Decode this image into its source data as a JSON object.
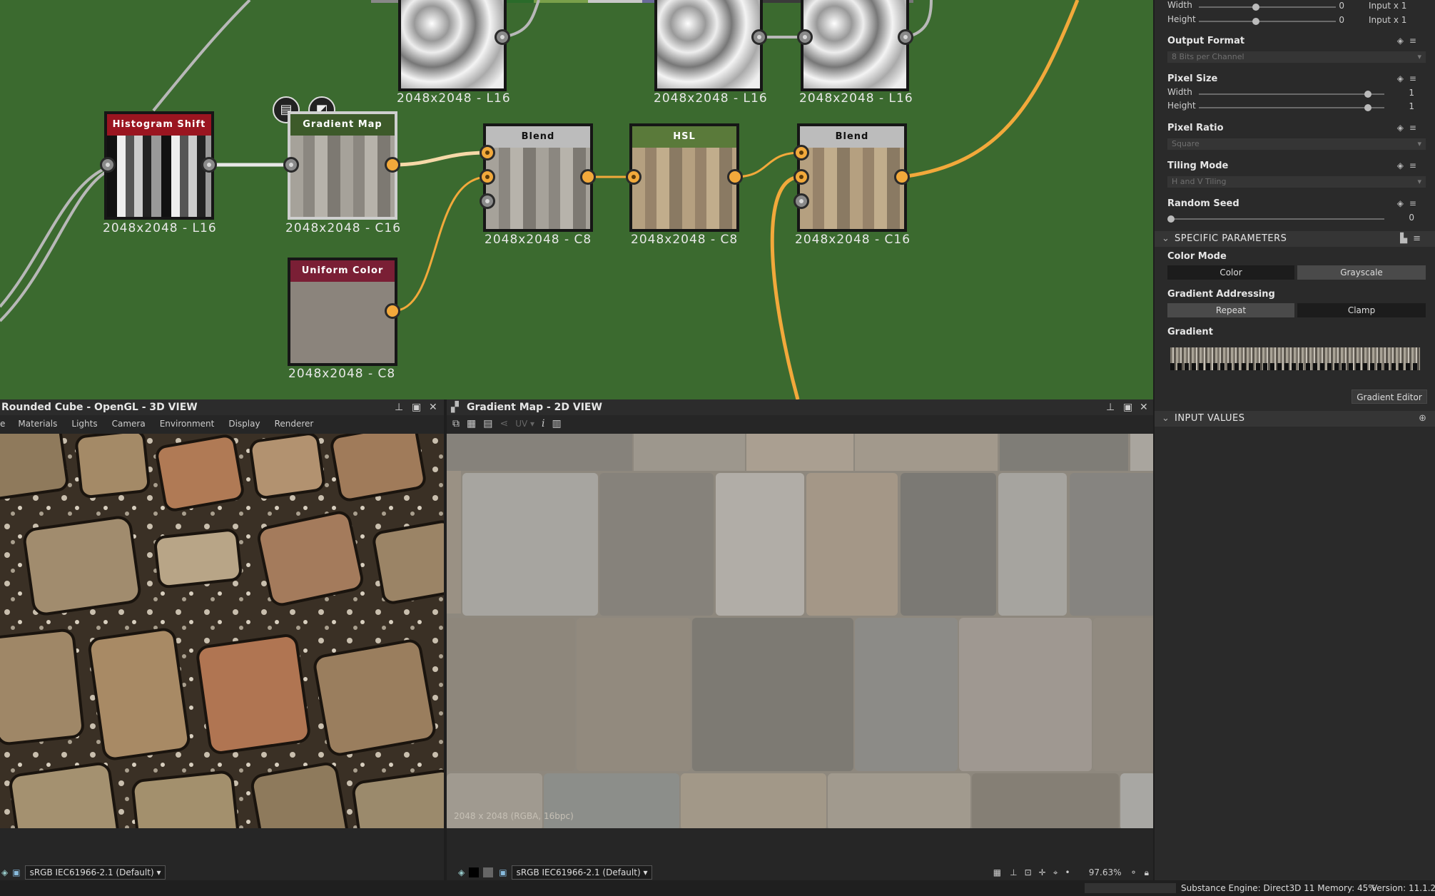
{
  "graph": {
    "nodes": {
      "histogram_shift": {
        "title": "Histogram Shift",
        "label": "2048x2048 - L16"
      },
      "gradient_map": {
        "title": "Gradient Map",
        "label": "2048x2048 - C16"
      },
      "uniform_color": {
        "title": "Uniform Color",
        "label": "2048x2048 - C8"
      },
      "blend1": {
        "title": "Blend",
        "label": "2048x2048 - C8"
      },
      "hsl": {
        "title": "HSL",
        "label": "2048x2048 - C8"
      },
      "blend2": {
        "title": "Blend",
        "label": "2048x2048 - C16"
      },
      "top1": {
        "label": "2048x2048 - L16"
      },
      "top2": {
        "label": "2048x2048 - L16"
      },
      "top3": {
        "label": "2048x2048 - L16"
      }
    },
    "colors": {
      "background": "#3b6a2f",
      "wire_orange": "#f2a93b",
      "wire_gray": "#b8b8b8"
    }
  },
  "view3d": {
    "title": "Rounded Cube - OpenGL - 3D VIEW",
    "menu": [
      "e",
      "Materials",
      "Lights",
      "Camera",
      "Environment",
      "Display",
      "Renderer"
    ],
    "colorspace": "sRGB IEC61966-2.1 (Default)"
  },
  "view2d": {
    "title": "Gradient Map - 2D VIEW",
    "toolbar_uv": "UV",
    "info": "2048 x 2048 (RGBA, 16bpc)",
    "colorspace": "sRGB IEC61966-2.1 (Default)",
    "zoom": "97.63%"
  },
  "props": {
    "top": {
      "width_label": "Width",
      "width_val": "0",
      "width_rel": "Input x 1",
      "height_label": "Height",
      "height_val": "0",
      "height_rel": "Input x 1"
    },
    "output_format": {
      "label": "Output Format",
      "value": "8 Bits per Channel"
    },
    "pixel_size": {
      "label": "Pixel Size",
      "width_label": "Width",
      "width_val": "1",
      "height_label": "Height",
      "height_val": "1"
    },
    "pixel_ratio": {
      "label": "Pixel Ratio",
      "value": "Square"
    },
    "tiling_mode": {
      "label": "Tiling Mode",
      "value": "H and V Tiling"
    },
    "random_seed": {
      "label": "Random Seed",
      "value": "0"
    },
    "specific_section": "SPECIFIC PARAMETERS",
    "color_mode": {
      "label": "Color Mode",
      "opt1": "Color",
      "opt2": "Grayscale"
    },
    "gradient_addressing": {
      "label": "Gradient Addressing",
      "opt1": "Repeat",
      "opt2": "Clamp"
    },
    "gradient": {
      "label": "Gradient",
      "editor_button": "Gradient Editor"
    },
    "input_section": "INPUT VALUES"
  },
  "status": {
    "engine": "Substance Engine: Direct3D 11  Memory: 45%",
    "version": "Version: 11.1.2"
  }
}
